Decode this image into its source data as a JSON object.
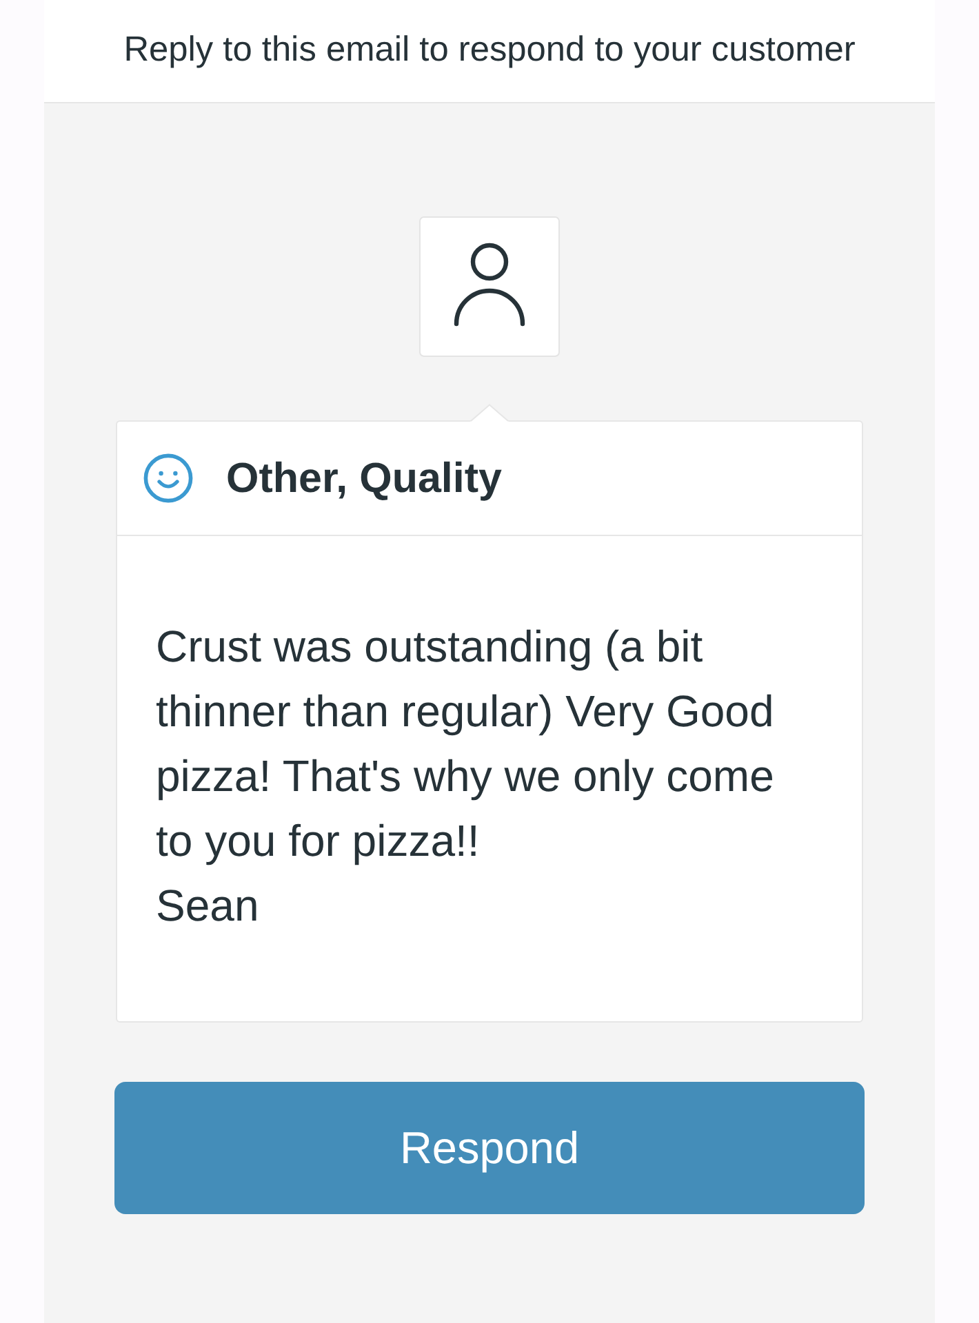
{
  "header": {
    "text": "Reply to this email to respond to your customer"
  },
  "feedback": {
    "category": "Other, Quality",
    "message": "Crust was outstanding (a bit thinner than regular) Very Good pizza! That's why we only come to you for pizza!!\nSean"
  },
  "button": {
    "label": "Respond"
  }
}
